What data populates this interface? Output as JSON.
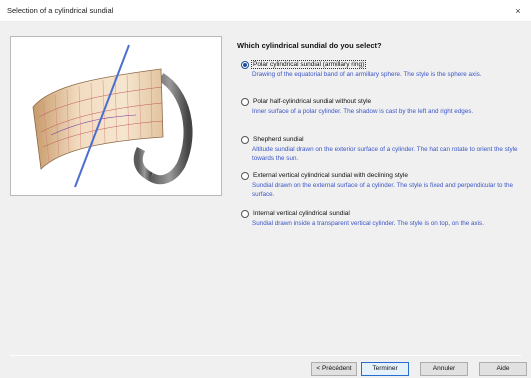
{
  "window": {
    "title": "Selection of a cylindrical sundial",
    "close_icon": "×"
  },
  "main": {
    "question": "Which cylindrical sundial do you select?",
    "options": [
      {
        "label": "Polar cylindrical sundial (armillary ring)",
        "description": "Drawing of the equatorial band of an armillary sphere. The style is the sphere axis.",
        "selected": true
      },
      {
        "label": "Polar half-cylindrical sundial without style",
        "description": "Inner surface of a polar cylinder. The shadow is cast by the left and right edges.",
        "selected": false
      },
      {
        "label": "Shepherd sundial",
        "description": "Altitude sundial drawn on the exterior surface of a cylinder. The hat can rotate to orient the style towards the sun.",
        "selected": false
      },
      {
        "label": "External vertical cylindrical sundial with declining style",
        "description": "Sundial drawn on the external surface of a cylinder. The style is fixed and perpendicular to the surface.",
        "selected": false
      },
      {
        "label": "Internal vertical cylindrical sundial",
        "description": "Sundial drawn inside a transparent vertical cylinder. The style is on top, on the axis.",
        "selected": false
      }
    ]
  },
  "buttons": {
    "previous": "< Précédent",
    "finish": "Terminer",
    "cancel": "Annuler",
    "help": "Aide"
  },
  "colors": {
    "link_blue": "#3b56c7",
    "focus_blue": "#2b6cd1",
    "dialog_bg": "#f0f0f0"
  }
}
